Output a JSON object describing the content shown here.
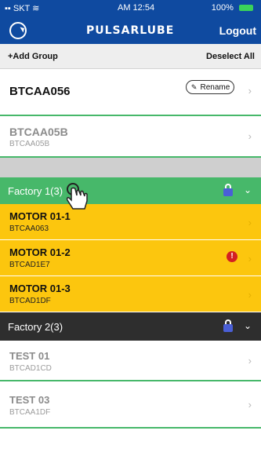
{
  "status_bar": {
    "carrier": "SKT",
    "time": "AM 12:54",
    "battery": "100%"
  },
  "nav": {
    "logo": "PULSARLUBE",
    "logout_label": "Logout"
  },
  "toolbar": {
    "add_group_label": "+Add Group",
    "deselect_all_label": "Deselect All"
  },
  "devices_top": [
    {
      "name": "BTCAA056",
      "action_label": "Rename"
    },
    {
      "name": "BTCAA05B",
      "id": "BTCAA05B"
    }
  ],
  "groups": [
    {
      "label": "Factory 1(3)",
      "color": "#47b86a",
      "items": [
        {
          "name": "MOTOR 01-1",
          "id": "BTCAA063",
          "alert": false
        },
        {
          "name": "MOTOR 01-2",
          "id": "BTCAD1E7",
          "alert": true
        },
        {
          "name": "MOTOR 01-3",
          "id": "BTCAD1DF",
          "alert": false
        }
      ]
    },
    {
      "label": "Factory 2(3)",
      "color": "#2e2e2e",
      "items": [
        {
          "name": "TEST 01",
          "id": "BTCAD1CD"
        },
        {
          "name": "TEST 03",
          "id": "BTCAA1DF"
        }
      ]
    }
  ],
  "icons": {
    "refresh": "refresh-icon",
    "pencil": "pencil-icon",
    "chevron": "chevron-right-icon",
    "lock": "lock-icon",
    "caret": "chevron-down-icon",
    "alert": "alert-icon",
    "cursor": "hand-pointer-icon"
  }
}
